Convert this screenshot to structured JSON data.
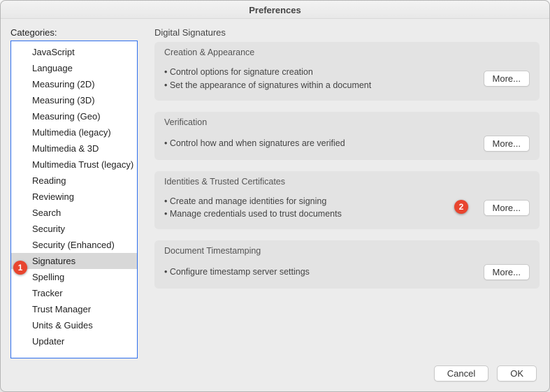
{
  "window": {
    "title": "Preferences"
  },
  "sidebar": {
    "label": "Categories:",
    "items": [
      {
        "label": "JavaScript"
      },
      {
        "label": "Language"
      },
      {
        "label": "Measuring (2D)"
      },
      {
        "label": "Measuring (3D)"
      },
      {
        "label": "Measuring (Geo)"
      },
      {
        "label": "Multimedia (legacy)"
      },
      {
        "label": "Multimedia & 3D"
      },
      {
        "label": "Multimedia Trust (legacy)"
      },
      {
        "label": "Reading"
      },
      {
        "label": "Reviewing"
      },
      {
        "label": "Search"
      },
      {
        "label": "Security"
      },
      {
        "label": "Security (Enhanced)"
      },
      {
        "label": "Signatures",
        "selected": true
      },
      {
        "label": "Spelling"
      },
      {
        "label": "Tracker"
      },
      {
        "label": "Trust Manager"
      },
      {
        "label": "Units & Guides"
      },
      {
        "label": "Updater"
      }
    ]
  },
  "main": {
    "heading": "Digital Signatures",
    "groups": [
      {
        "title": "Creation & Appearance",
        "bullets": [
          "Control options for signature creation",
          "Set the appearance of signatures within a document"
        ],
        "button": "More..."
      },
      {
        "title": "Verification",
        "bullets": [
          "Control how and when signatures are verified"
        ],
        "button": "More..."
      },
      {
        "title": "Identities & Trusted Certificates",
        "bullets": [
          "Create and manage identities for signing",
          "Manage credentials used to trust documents"
        ],
        "button": "More..."
      },
      {
        "title": "Document Timestamping",
        "bullets": [
          "Configure timestamp server settings"
        ],
        "button": "More..."
      }
    ]
  },
  "footer": {
    "cancel": "Cancel",
    "ok": "OK"
  },
  "callouts": {
    "c1": "1",
    "c2": "2"
  }
}
